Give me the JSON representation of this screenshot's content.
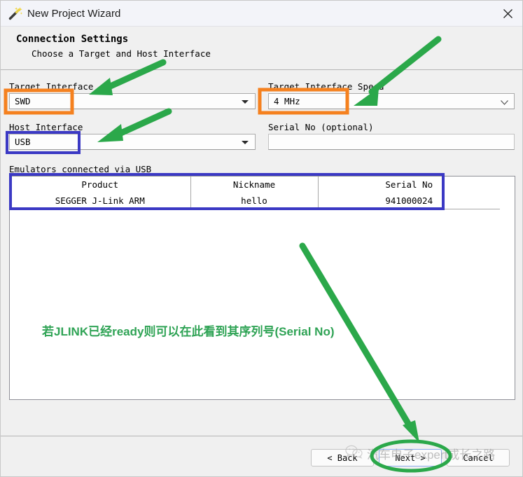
{
  "window": {
    "title": "New Project Wizard",
    "icon": "magic-wand-icon",
    "close_label": "×"
  },
  "header": {
    "title": "Connection Settings",
    "subtitle": "Choose a Target and Host Interface"
  },
  "form": {
    "target_interface": {
      "label": "Target Interface",
      "value": "SWD",
      "highlight_color": "#F5811F"
    },
    "target_interface_speed": {
      "label": "Target Interface Speed",
      "value": "4 MHz",
      "highlight_color": "#F5811F"
    },
    "host_interface": {
      "label": "Host Interface",
      "value": "USB",
      "highlight_color": "#3B39C4"
    },
    "serial_no": {
      "label": "Serial No (optional)",
      "value": "",
      "placeholder": ""
    }
  },
  "emulators": {
    "label": "Emulators connected via USB",
    "columns": [
      "Product",
      "Nickname",
      "Serial No"
    ],
    "rows": [
      {
        "product": "SEGGER J-Link ARM",
        "nickname": "hello",
        "serial_no": "941000024"
      }
    ],
    "highlight_color": "#3B39C4"
  },
  "annotations": {
    "note_text": "若JLINK已经ready则可以在此看到其序列号(Serial No)",
    "note_color": "#2FA355",
    "arrow_color": "#2BA84A",
    "circle_color": "#2BA84A"
  },
  "footer": {
    "back_label": "< Back",
    "next_label": "Next >",
    "cancel_label": "Cancel"
  },
  "watermark": {
    "text": "汽车电子expert成长之路",
    "icon": "wechat-icon"
  }
}
